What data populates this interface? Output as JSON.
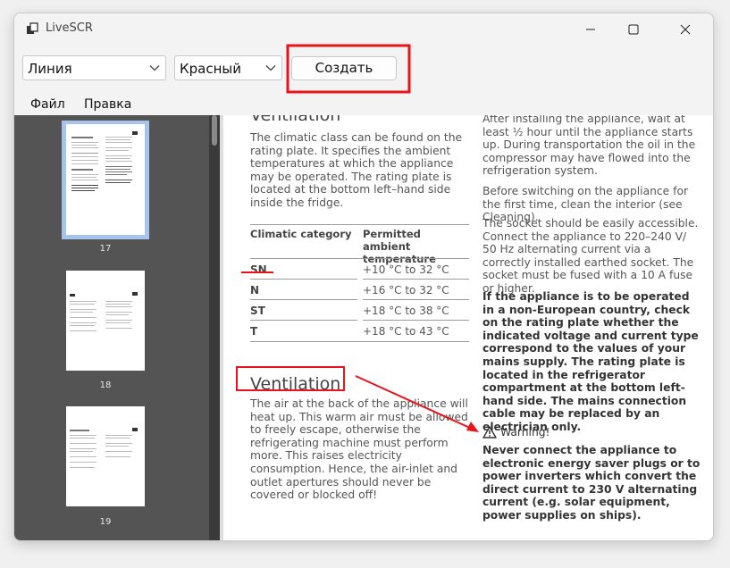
{
  "window": {
    "title": "LiveSCR"
  },
  "toolbar": {
    "shape_select": "Линия",
    "color_select": "Красный",
    "create_label": "Создать"
  },
  "menu": {
    "file": "Файл",
    "edit": "Правка"
  },
  "thumbnails": [
    {
      "label": "17"
    },
    {
      "label": "18"
    },
    {
      "label": "19"
    }
  ],
  "document": {
    "left": {
      "heading_top": "Ventilation",
      "intro": "The climatic class can be found on the rating plate. It specifies the ambient temperatures at which the appliance may be operated. The rating plate is located at the bottom left–hand side inside the fridge.",
      "table": {
        "col1": "Climatic category",
        "col2": "Permitted ambient temperature",
        "rows": [
          {
            "cat": "SN",
            "temp": "+10 °C to 32 °C"
          },
          {
            "cat": "N",
            "temp": "+16 °C to 32 °C"
          },
          {
            "cat": "ST",
            "temp": "+18 °C to 38 °C"
          },
          {
            "cat": "T",
            "temp": "+18 °C to 43 °C"
          }
        ]
      },
      "heading": "Ventilation",
      "ventilation_text": "The air at the back of the appliance will heat up. This warm air must be allowed to freely escape, otherwise the refrigerating machine must perform more. This raises electricity consumption. Hence, the air-inlet and outlet apertures should never be covered or blocked off!"
    },
    "right": {
      "p1": "After installing the appliance, wait at least ½ hour until the appliance starts up. During transportation the oil in the compressor may have flowed into the refrigeration system.",
      "p2": "Before switching on the appliance for the first time, clean the interior (see Cleaning).",
      "p3": "The socket should be easily accessible. Connect the appliance to 220–240 V/ 50 Hz alternating current via a correctly installed earthed socket. The socket must be fused with a 10 A fuse or higher.",
      "p4": "If the appliance is to be operated in a non-European country, check on the rating plate whether the indicated voltage and current type correspond to the values of your mains supply. The rating plate is located in the refrigerator compartment at the bottom left-hand side. The mains connection cable may be replaced by an electrician only.",
      "warning_title": "Warning!",
      "warning_text": "Never connect the appliance to electronic energy saver plugs or to power inverters which convert the direct current to 230 V alternating current (e.g. solar equipment, power supplies on ships)."
    }
  },
  "colors": {
    "annotation": "#e8141c",
    "selection": "#a7c4ee",
    "sidebar": "#545454"
  }
}
